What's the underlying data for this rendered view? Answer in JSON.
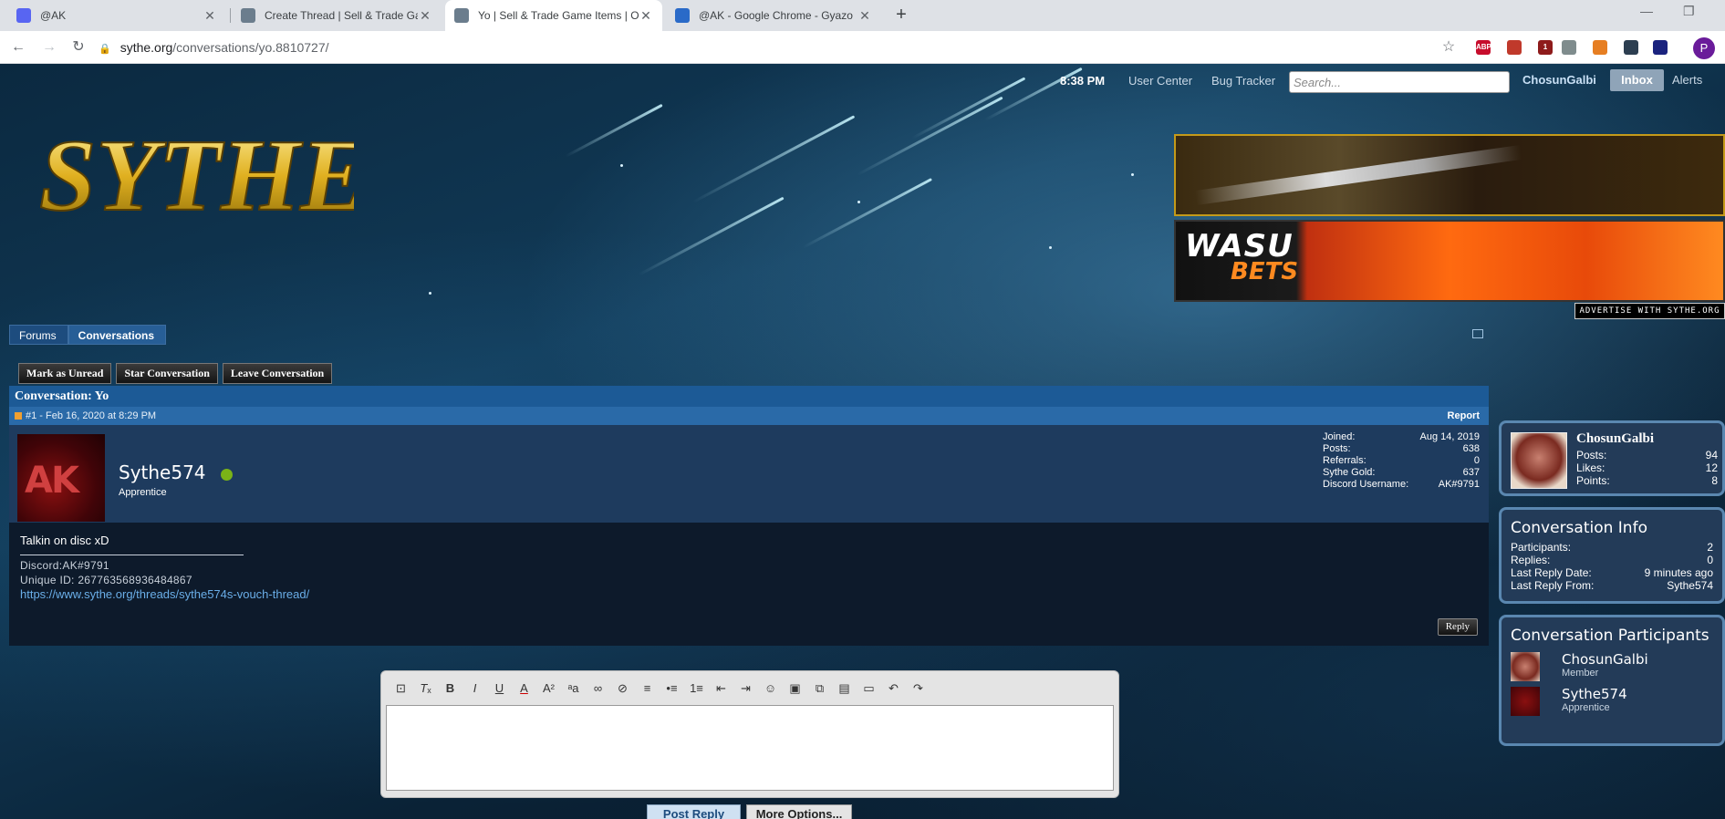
{
  "browser": {
    "tabs": [
      {
        "title": "@AK",
        "favicon_color": "#5865f2",
        "active": false
      },
      {
        "title": "Create Thread | Sell & Trade Gam",
        "favicon_color": "#6b7d8d",
        "active": false
      },
      {
        "title": "Yo | Sell & Trade Game Items | OS",
        "favicon_color": "#6b7d8d",
        "active": true
      },
      {
        "title": "@AK - Google Chrome - Gyazo",
        "favicon_color": "#2a6ac8",
        "active": false
      }
    ],
    "url_host": "sythe.org",
    "url_path": "/conversations/yo.8810727/",
    "profile_initial": "P",
    "extensions": [
      {
        "label": "ABP",
        "color": "#c70d2c"
      },
      {
        "label": "",
        "color": "#c0392b"
      },
      {
        "label": "1",
        "color": "#8e1b1b"
      },
      {
        "label": "",
        "color": "#7f8c8d"
      },
      {
        "label": "",
        "color": "#e67e22"
      },
      {
        "label": "",
        "color": "#2c3e50"
      },
      {
        "label": "",
        "color": "#1a237e"
      }
    ]
  },
  "header": {
    "time": "8:38 PM",
    "user_center": "User Center",
    "bug_tracker": "Bug Tracker",
    "search_placeholder": "Search...",
    "username": "ChosunGalbi",
    "inbox": "Inbox",
    "alerts": "Alerts",
    "logo_text": "SYTHE",
    "advertise": "ADVERTISE WITH SYTHE.ORG",
    "ad2_text_1": "WASU",
    "ad2_text_2": "BETS"
  },
  "breadcrumb": [
    "Forums",
    "Conversations"
  ],
  "actions": [
    "Mark as Unread",
    "Star Conversation",
    "Leave Conversation"
  ],
  "conversation": {
    "title": "Conversation: Yo",
    "message_meta": "#1 - Feb 16, 2020 at 8:29 PM",
    "report": "Report",
    "author": "Sythe574",
    "author_avatar_text": "AK",
    "rank": "Apprentice",
    "stats": [
      {
        "label": "Joined:",
        "value": "Aug 14, 2019"
      },
      {
        "label": "Posts:",
        "value": "638"
      },
      {
        "label": "Referrals:",
        "value": "0"
      },
      {
        "label": "Sythe Gold:",
        "value": "637"
      },
      {
        "label": "Discord Username:",
        "value": "AK#9791"
      }
    ],
    "body": "Talkin on disc xD",
    "sig_discord": "Discord:AK#9791",
    "sig_unique": "Unique ID: 267763568936484867",
    "sig_link": "https://www.sythe.org/threads/sythe574s-vouch-thread/",
    "reply": "Reply"
  },
  "editor": {
    "post_reply": "Post Reply",
    "more_options": "More Options..."
  },
  "sidebar": {
    "me": {
      "name": "ChosunGalbi",
      "stats": [
        {
          "label": "Posts:",
          "value": "94"
        },
        {
          "label": "Likes:",
          "value": "12"
        },
        {
          "label": "Points:",
          "value": "8"
        }
      ]
    },
    "info": {
      "title": "Conversation Info",
      "rows": [
        {
          "label": "Participants:",
          "value": "2"
        },
        {
          "label": "Replies:",
          "value": "0"
        },
        {
          "label": "Last Reply Date:",
          "value": "9 minutes ago"
        },
        {
          "label": "Last Reply From:",
          "value": "Sythe574"
        }
      ]
    },
    "participants": {
      "title": "Conversation Participants",
      "people": [
        {
          "name": "ChosunGalbi",
          "rank": "Member"
        },
        {
          "name": "Sythe574",
          "rank": "Apprentice"
        }
      ]
    }
  },
  "colors": {
    "link": "#6aaee8",
    "online": "#7ab317",
    "header_blue": "#1c5a96"
  }
}
